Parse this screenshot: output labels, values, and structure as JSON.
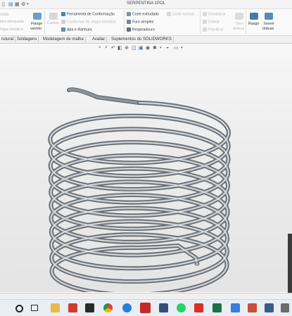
{
  "window": {
    "title": "SERPENTINA 1POL"
  },
  "ribbon": {
    "items": [
      {
        "label": "olado",
        "dim": true
      },
      {
        "label": "ldra adequada",
        "dim": true
      },
      {
        "label": "hapa metálica",
        "dim": true
      },
      {
        "label": "Flange",
        "dim": false
      },
      {
        "label": "varrido",
        "dim": false
      },
      {
        "label": "Cantos",
        "dim": true
      },
      {
        "label": "Ferramenta de Conformação",
        "dim": false
      },
      {
        "label": "Conformar de chapa metálica",
        "dim": true
      },
      {
        "label": "Aba e Ranhura",
        "dim": false
      },
      {
        "label": "Corte extrudado",
        "dim": false
      },
      {
        "label": "Corte normal",
        "dim": true
      },
      {
        "label": "Furo simples",
        "dim": false
      },
      {
        "label": "Respiradouro",
        "dim": false
      },
      {
        "label": "Desdobrar",
        "dim": true
      },
      {
        "label": "Dobrar",
        "dim": true
      },
      {
        "label": "Planificar",
        "dim": true
      },
      {
        "label": "Sem",
        "dim": true
      },
      {
        "label": "dobras",
        "dim": true
      },
      {
        "label": "Rasgo",
        "dim": false
      },
      {
        "label": "Inserir",
        "dim": false
      },
      {
        "label": "dobras",
        "dim": false
      }
    ]
  },
  "tabs": [
    "rutural",
    "Soldagens",
    "Modelagem de malha",
    "Avaliar",
    "Suplementos do SOLIDWORKS"
  ],
  "model": {
    "turns": 11,
    "tube_color": "#8f959b",
    "highlight_color": "#eceef1"
  },
  "taskbar": {
    "search_icon": "search-icon",
    "task_icon": "task-view-icon"
  }
}
